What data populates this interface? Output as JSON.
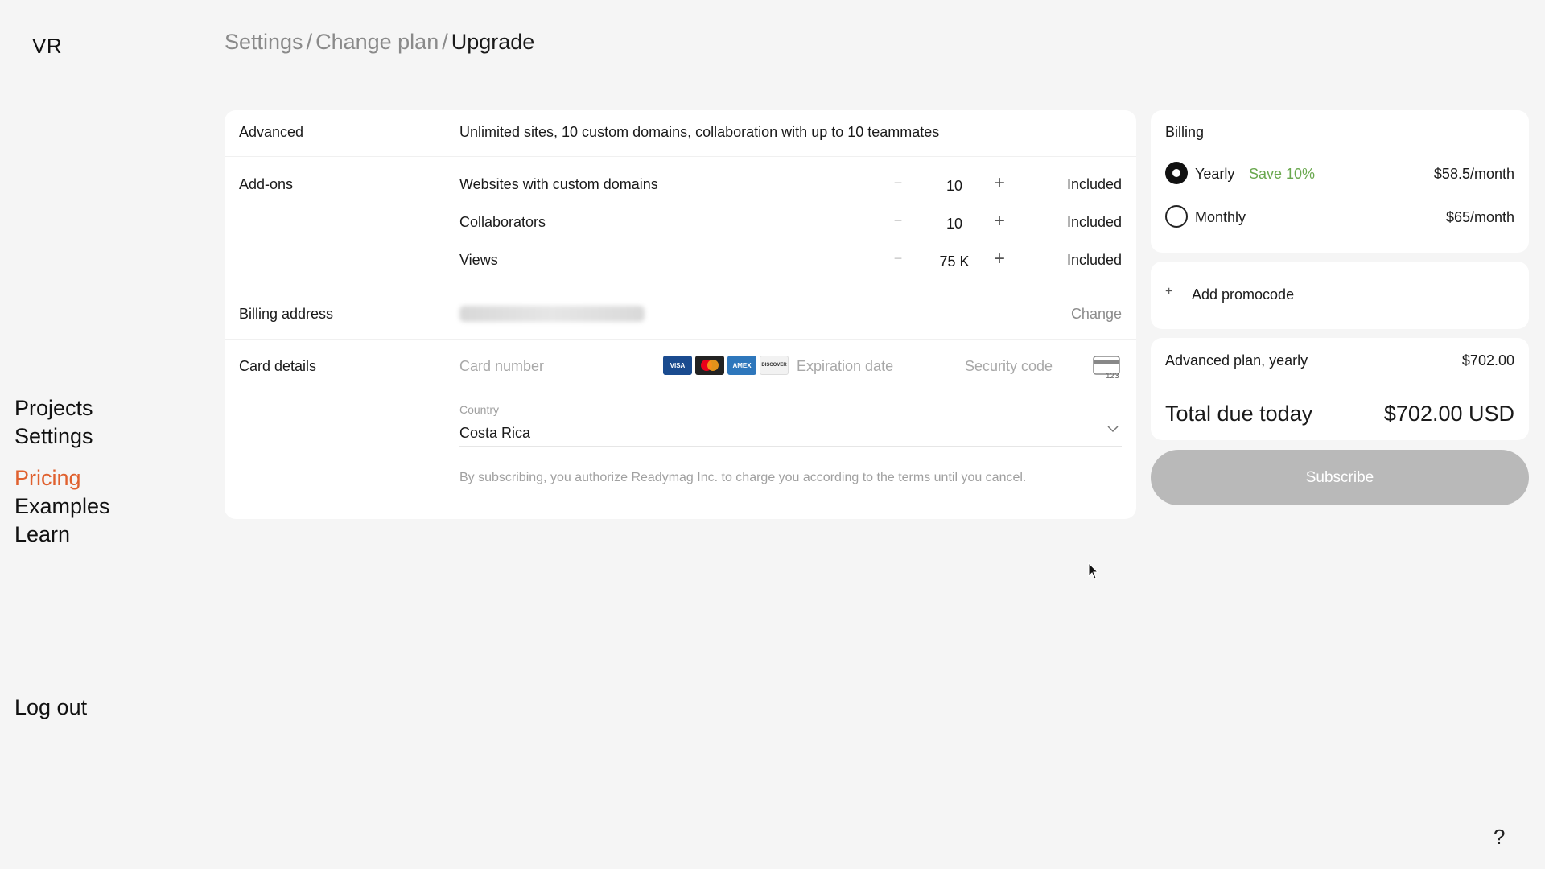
{
  "sidebar": {
    "logo": "VR",
    "nav_top": [
      "Projects",
      "Settings"
    ],
    "nav_mid": [
      "Pricing",
      "Examples",
      "Learn"
    ],
    "active_item": "Pricing",
    "logout": "Log out"
  },
  "breadcrumb": {
    "items": [
      "Settings",
      "Change plan"
    ],
    "current": "Upgrade",
    "separator": "/"
  },
  "plan": {
    "label": "Advanced",
    "description": "Unlimited sites, 10 custom domains, collaboration with up to 10 teammates"
  },
  "addons": {
    "label": "Add-ons",
    "items": [
      {
        "name": "Websites with custom domains",
        "value": "10",
        "status": "Included"
      },
      {
        "name": "Collaborators",
        "value": "10",
        "status": "Included"
      },
      {
        "name": "Views",
        "value": "75 K",
        "status": "Included"
      }
    ],
    "minus_symbol": "−",
    "plus_symbol": "+"
  },
  "billing_address": {
    "label": "Billing address",
    "change_label": "Change"
  },
  "card_details": {
    "label": "Card details",
    "card_number_placeholder": "Card number",
    "expiration_placeholder": "Expiration date",
    "security_code_placeholder": "Security code",
    "card_brands": [
      "VISA",
      "Mastercard",
      "AMEX",
      "DISCOVER"
    ],
    "cvc_hint": "123",
    "country_label": "Country",
    "country_value": "Costa Rica",
    "terms": "By subscribing, you authorize Readymag Inc. to charge you according to the terms until you cancel."
  },
  "billing": {
    "title": "Billing",
    "options": [
      {
        "label": "Yearly",
        "badge": "Save 10%",
        "price": "$58.5/month",
        "selected": true
      },
      {
        "label": "Monthly",
        "badge": "",
        "price": "$65/month",
        "selected": false
      }
    ]
  },
  "promo": {
    "icon_symbol": "+",
    "label": "Add promocode"
  },
  "summary": {
    "line_label": "Advanced plan, yearly",
    "line_amount": "$702.00",
    "total_label": "Total due today",
    "total_amount": "$702.00 USD"
  },
  "subscribe_label": "Subscribe",
  "help_label": "?",
  "colors": {
    "accent": "#e0612f",
    "save_green": "#6aa84f",
    "background": "#f5f5f5",
    "button_disabled": "#b9b9b9"
  }
}
